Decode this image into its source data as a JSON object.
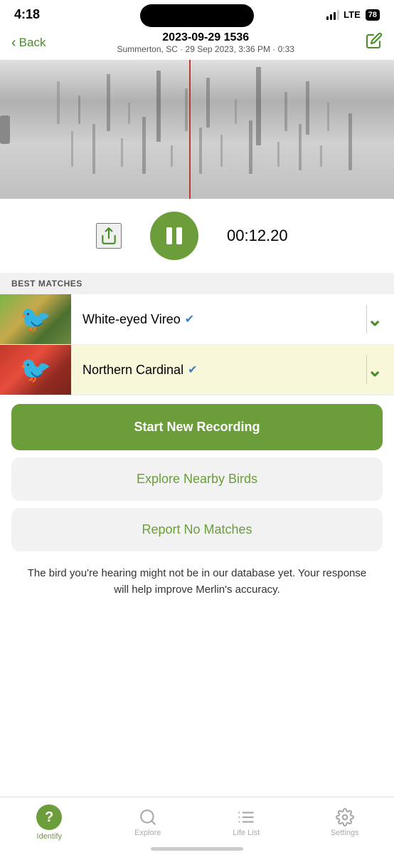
{
  "statusBar": {
    "time": "4:18",
    "lte": "LTE",
    "battery": "78"
  },
  "header": {
    "back_label": "Back",
    "title": "2023-09-29 1536",
    "subtitle": "Summerton, SC · 29 Sep 2023, 3:36 PM · 0:33"
  },
  "controls": {
    "timer": "00:12.20",
    "pause_label": "pause"
  },
  "bestMatches": {
    "section_label": "BEST MATCHES",
    "items": [
      {
        "name": "White-eyed Vireo",
        "verified": true,
        "highlighted": false
      },
      {
        "name": "Northern Cardinal",
        "verified": true,
        "highlighted": true
      }
    ]
  },
  "actions": {
    "start_recording": "Start New Recording",
    "explore_nearby": "Explore Nearby Birds",
    "report_no_matches": "Report No Matches",
    "help_text": "The bird you're hearing might not be in our database yet. Your response will help improve Merlin's accuracy."
  },
  "bottomNav": {
    "items": [
      {
        "label": "Identify",
        "icon": "?",
        "active": true
      },
      {
        "label": "Explore",
        "icon": "search",
        "active": false
      },
      {
        "label": "Life List",
        "icon": "list",
        "active": false
      },
      {
        "label": "Settings",
        "icon": "gear",
        "active": false
      }
    ]
  }
}
